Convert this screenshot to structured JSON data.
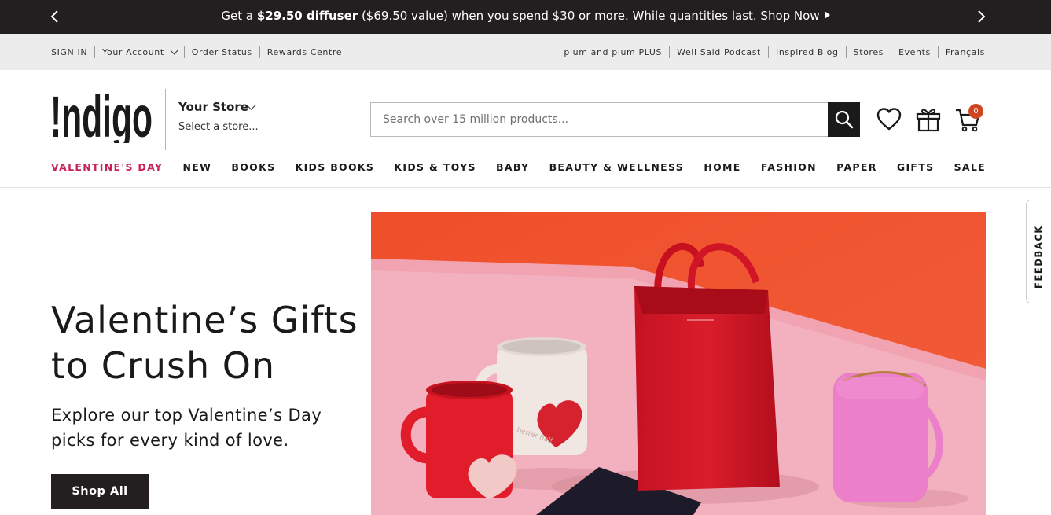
{
  "promo": {
    "prefix": "Get a ",
    "highlight": "$29.50 diffuser",
    "suffix": " ($69.50 value) when you spend $30 or more. While quantities last. Shop Now"
  },
  "utility": {
    "sign_in": "SIGN IN",
    "your_account": "Your Account",
    "order_status": "Order Status",
    "rewards": "Rewards Centre",
    "plum": "plum and plum PLUS",
    "podcast": "Well Said Podcast",
    "blog": "Inspired Blog",
    "stores": "Stores",
    "events": "Events",
    "francais": "Français"
  },
  "header": {
    "logo_text": "!ndigo",
    "store_title": "Your Store",
    "store_sub": "Select a store...",
    "search_placeholder": "Search over 15 million products...",
    "cart_count": "0"
  },
  "nav": [
    "VALENTINE'S DAY",
    "NEW",
    "BOOKS",
    "KIDS BOOKS",
    "KIDS & TOYS",
    "BABY",
    "BEAUTY & WELLNESS",
    "HOME",
    "FASHION",
    "PAPER",
    "GIFTS",
    "SALE"
  ],
  "hero": {
    "title": "Valentine’s Gifts to Crush On",
    "subtitle": "Explore our top Valentine’s Day picks for every kind of love.",
    "cta": "Shop All",
    "mug_text": "better half"
  },
  "feedback": "FEEDBACK",
  "colors": {
    "accent_valentine": "#c8215e",
    "banner_bg": "#231f20",
    "cart_badge": "#cf4520",
    "hero_orange": "#f0522e",
    "hero_pink": "#f3b1bf"
  }
}
